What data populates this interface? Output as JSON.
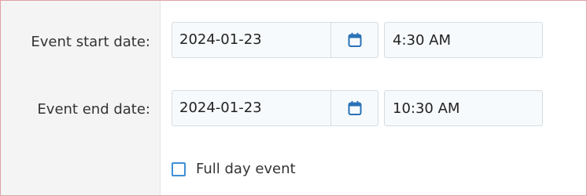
{
  "start": {
    "label": "Event start date:",
    "date_value": "2024-01-23",
    "time_value": "4:30 AM"
  },
  "end": {
    "label": "Event end date:",
    "date_value": "2024-01-23",
    "time_value": "10:30 AM"
  },
  "full_day": {
    "label": "Full day event",
    "checked": false
  },
  "icons": {
    "calendar": "calendar-icon"
  },
  "colors": {
    "accent": "#2a72b8",
    "checkbox_border": "#3f8fd6",
    "frame_border": "#e0a0a4"
  }
}
